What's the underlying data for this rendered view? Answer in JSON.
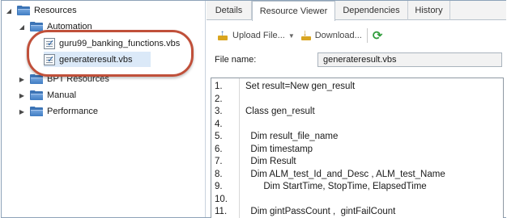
{
  "tree": {
    "root": {
      "label": "Resources"
    },
    "automation": {
      "label": "Automation"
    },
    "files": [
      {
        "label": "guru99_banking_functions.vbs"
      },
      {
        "label": "generateresult.vbs"
      }
    ],
    "bpt": {
      "label": "BPT Resources"
    },
    "manual": {
      "label": "Manual"
    },
    "performance": {
      "label": "Performance"
    }
  },
  "tabs": [
    {
      "label": "Details"
    },
    {
      "label": "Resource Viewer"
    },
    {
      "label": "Dependencies"
    },
    {
      "label": "History"
    }
  ],
  "toolbar": {
    "upload_label": "Upload File...",
    "download_label": "Download..."
  },
  "file": {
    "name_label": "File name:",
    "name_value": "generateresult.vbs"
  },
  "code_lines": [
    {
      "num": "1.",
      "text": "Set result=New gen_result"
    },
    {
      "num": "2.",
      "text": ""
    },
    {
      "num": "3.",
      "text": "Class gen_result"
    },
    {
      "num": "4.",
      "text": ""
    },
    {
      "num": "5.",
      "text": "  Dim result_file_name"
    },
    {
      "num": "6.",
      "text": "  Dim timestamp"
    },
    {
      "num": "7.",
      "text": "  Dim Result"
    },
    {
      "num": "8.",
      "text": "  Dim ALM_test_Id_and_Desc , ALM_test_Name"
    },
    {
      "num": "9.",
      "text": "       Dim StartTime, StopTime, ElapsedTime"
    },
    {
      "num": "10.",
      "text": ""
    },
    {
      "num": "11.",
      "text": "  Dim gintPassCount ,  gintFailCount"
    }
  ]
}
